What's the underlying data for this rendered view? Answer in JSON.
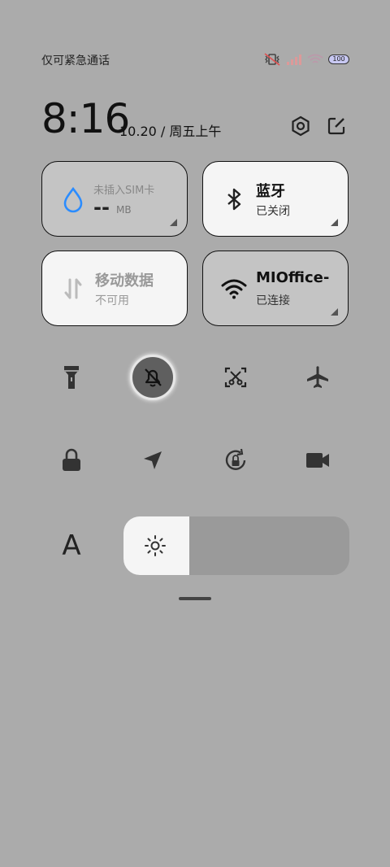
{
  "status": {
    "carrier": "仅可紧急通话",
    "battery": "100"
  },
  "header": {
    "time": "8:16",
    "date": "10.20 / 周五上午"
  },
  "tiles": {
    "sim": {
      "title": "未插入SIM卡",
      "value": "--",
      "unit": "MB"
    },
    "bluetooth": {
      "title": "蓝牙",
      "status": "已关闭"
    },
    "mobile_data": {
      "title": "移动数据",
      "status": "不可用"
    },
    "wifi": {
      "title": "MIOffice-",
      "status": "已连接"
    }
  },
  "toggles": {
    "row1": [
      "flashlight-icon",
      "mute-bell-icon",
      "screenshot-scissors-icon",
      "airplane-icon"
    ],
    "row2": [
      "lock-icon",
      "location-icon",
      "rotation-lock-icon",
      "video-camera-icon"
    ]
  },
  "brightness": {
    "font_label": "A",
    "level": 0.29
  },
  "colors": {
    "background": "#ababab",
    "tile_active": "#f5f5f5",
    "tile_inactive": "#c4c4c4",
    "accent_water": "#2b8cff"
  }
}
